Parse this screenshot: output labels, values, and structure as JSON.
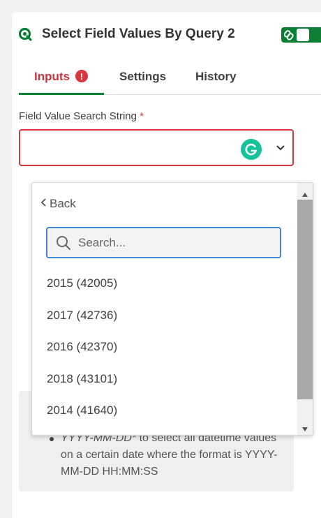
{
  "header": {
    "title": "Select Field Values By Query 2",
    "logo_icon": "qlik-logo-icon",
    "toggle_icon": "link-icon"
  },
  "tabs": [
    {
      "label": "Inputs",
      "active": true,
      "alert": "!"
    },
    {
      "label": "Settings",
      "active": false
    },
    {
      "label": "History",
      "active": false
    }
  ],
  "field": {
    "label": "Field Value Search String",
    "required_marker": "*",
    "value": ""
  },
  "dropdown": {
    "back_label": "Back",
    "search_placeholder": "Search...",
    "options": [
      "2015 (42005)",
      "2017 (42736)",
      "2016 (42370)",
      "2018 (43101)",
      "2014 (41640)"
    ]
  },
  "help": {
    "item_em": "YYYY-MM-DD*",
    "item_text": " to select all datetime values on a certain date where the format is YYYY-MM-DD HH:MM:SS"
  },
  "colors": {
    "accent_green": "#0b7f33",
    "error_red": "#d8373f",
    "focus_blue": "#3f8ad8",
    "grammarly_green": "#15c39a"
  }
}
